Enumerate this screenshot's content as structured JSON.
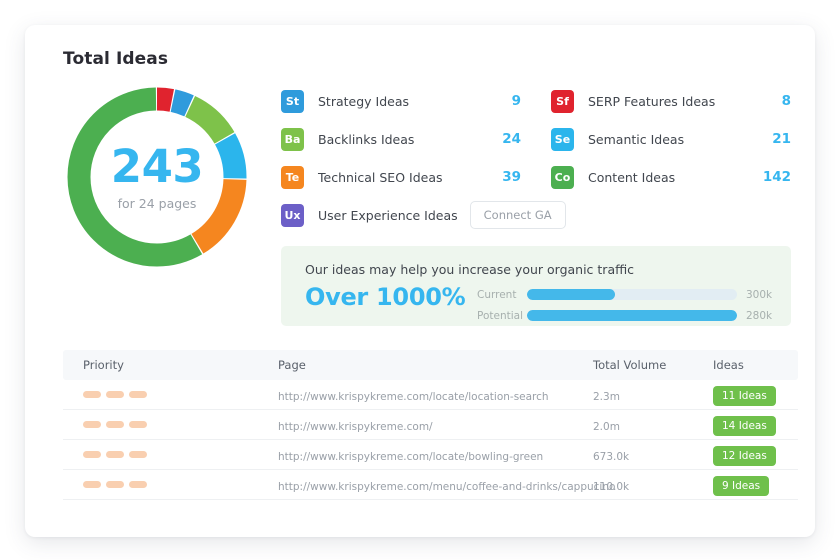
{
  "card": {
    "title": "Total Ideas"
  },
  "donut": {
    "total": "243",
    "subtitle": "for 24 pages"
  },
  "legend": {
    "left": [
      {
        "badge": "St",
        "label": "Strategy Ideas",
        "value": "9",
        "color": "#2f9bdc"
      },
      {
        "badge": "Ba",
        "label": "Backlinks Ideas",
        "value": "24",
        "color": "#7ec24a"
      },
      {
        "badge": "Te",
        "label": "Technical SEO Ideas",
        "value": "39",
        "color": "#f5861f"
      },
      {
        "badge": "Ux",
        "label": "User Experience Ideas",
        "value": "",
        "color": "#6c5fc7",
        "button": "Connect GA"
      }
    ],
    "right": [
      {
        "badge": "Sf",
        "label": "SERP Features Ideas",
        "value": "8",
        "color": "#e0232e"
      },
      {
        "badge": "Se",
        "label": "Semantic Ideas",
        "value": "21",
        "color": "#2bb5ec"
      },
      {
        "badge": "Co",
        "label": "Content Ideas",
        "value": "142",
        "color": "#4caf50"
      }
    ]
  },
  "banner": {
    "title": "Our ideas may help you increase your organic traffic",
    "percent": "Over 1000%",
    "bars": [
      {
        "name": "Current",
        "value": "300k",
        "fill_pct": 42
      },
      {
        "name": "Potential",
        "value": "280k",
        "fill_pct": 100
      }
    ]
  },
  "table": {
    "columns": [
      "Priority",
      "Page",
      "Total Volume",
      "Ideas"
    ],
    "rows": [
      {
        "priority_bars": 3,
        "page": "http://www.krispykreme.com/locate/location-search",
        "volume": "2.3m",
        "ideas": "11 Ideas"
      },
      {
        "priority_bars": 3,
        "page": "http://www.krispykreme.com/",
        "volume": "2.0m",
        "ideas": "14 Ideas"
      },
      {
        "priority_bars": 3,
        "page": "http://www.krispykreme.com/locate/bowling-green",
        "volume": "673.0k",
        "ideas": "12 Ideas"
      },
      {
        "priority_bars": 3,
        "page": "http://www.krispykreme.com/menu/coffee-and-drinks/cappucino",
        "volume": "110.0k",
        "ideas": "9 Ideas"
      }
    ]
  },
  "chart_data": {
    "type": "pie",
    "title": "Total Ideas",
    "center_value": 243,
    "center_label": "for 24 pages",
    "categories": [
      "SERP Features Ideas",
      "Strategy Ideas",
      "Backlinks Ideas",
      "Semantic Ideas",
      "Technical SEO Ideas",
      "Content Ideas"
    ],
    "values": [
      8,
      9,
      24,
      21,
      39,
      142
    ],
    "colors": [
      "#e0232e",
      "#2f9bdc",
      "#7ec24a",
      "#2bb5ec",
      "#f5861f",
      "#4caf50"
    ],
    "total": 243,
    "donut": true,
    "legend": "right"
  }
}
